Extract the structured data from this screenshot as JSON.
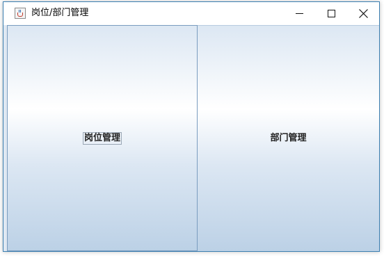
{
  "window": {
    "title": "岗位/部门管理",
    "app_icon": "java-cup-icon",
    "controls": {
      "minimize": "minimize-icon",
      "maximize": "maximize-icon",
      "close": "close-icon"
    }
  },
  "buttons": {
    "post_management": "岗位管理",
    "department_management": "部门管理"
  },
  "colors": {
    "window_border": "#3c7fb1",
    "button_gradient_top": "#dce7f3",
    "button_gradient_mid": "#ffffff",
    "button_gradient_bottom": "#bcd1e6"
  }
}
